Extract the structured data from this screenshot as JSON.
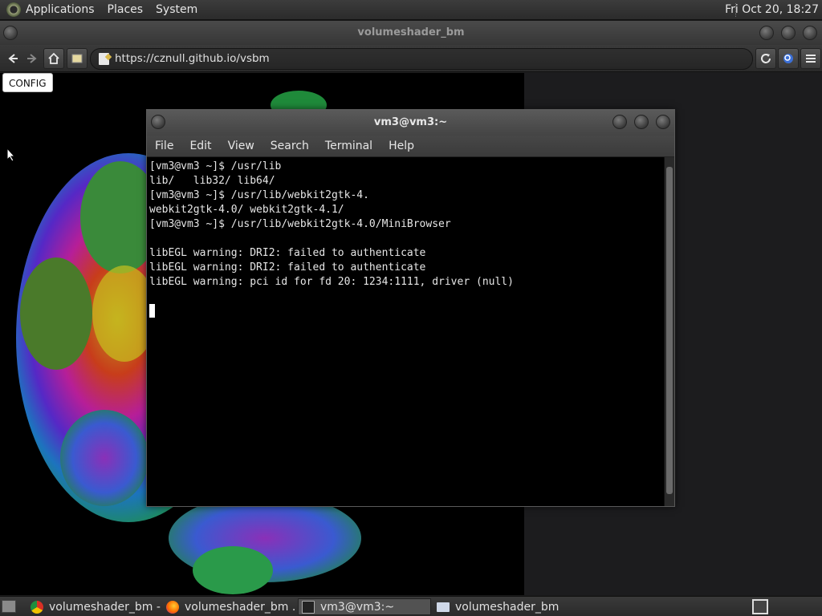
{
  "top_panel": {
    "menus": [
      "Applications",
      "Places",
      "System"
    ],
    "clock": "Fri Oct 20, 18:27"
  },
  "browser": {
    "title": "volumeshader_bm",
    "url": "https://cznull.github.io/vsbm",
    "config_label": "CONFIG"
  },
  "terminal": {
    "title": "vm3@vm3:~",
    "menu": [
      "File",
      "Edit",
      "View",
      "Search",
      "Terminal",
      "Help"
    ],
    "lines": [
      "[vm3@vm3 ~]$ /usr/lib",
      "lib/   lib32/ lib64/",
      "[vm3@vm3 ~]$ /usr/lib/webkit2gtk-4.",
      "webkit2gtk-4.0/ webkit2gtk-4.1/",
      "[vm3@vm3 ~]$ /usr/lib/webkit2gtk-4.0/MiniBrowser",
      "",
      "libEGL warning: DRI2: failed to authenticate",
      "libEGL warning: DRI2: failed to authenticate",
      "libEGL warning: pci id for fd 20: 1234:1111, driver (null)",
      ""
    ]
  },
  "taskbar": {
    "items": [
      {
        "label": "volumeshader_bm -...",
        "icon": "chrome-icon"
      },
      {
        "label": "volumeshader_bm ...",
        "icon": "firefox-icon"
      },
      {
        "label": "vm3@vm3:~",
        "icon": "terminal-icon"
      },
      {
        "label": "volumeshader_bm",
        "icon": "window-icon"
      }
    ]
  }
}
